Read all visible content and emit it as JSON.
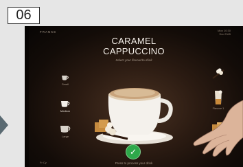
{
  "step": {
    "number": "06"
  },
  "screen": {
    "brand": "FRANKE",
    "status_top_right": [
      "Mon 10:30",
      "Svc 2345"
    ],
    "title_line1": "CARAMEL",
    "title_line2": "CAPPUCCINO",
    "subtitle": "Select your flavour/to drink",
    "hint": "Press to process your drink",
    "corner_bottom_left": "Fr Cy",
    "cup_sizes": [
      {
        "label": "Small",
        "active": false
      },
      {
        "label": "Medium",
        "active": true
      },
      {
        "label": "Large",
        "active": false
      }
    ],
    "toppings": [
      {
        "label": ""
      },
      {
        "label": "Flavour 1"
      },
      {
        "label": "Flavour 2"
      }
    ],
    "confirm_icon": "check-icon",
    "colors": {
      "accent_green": "#2ea84a",
      "background": "#2b1b12"
    }
  }
}
